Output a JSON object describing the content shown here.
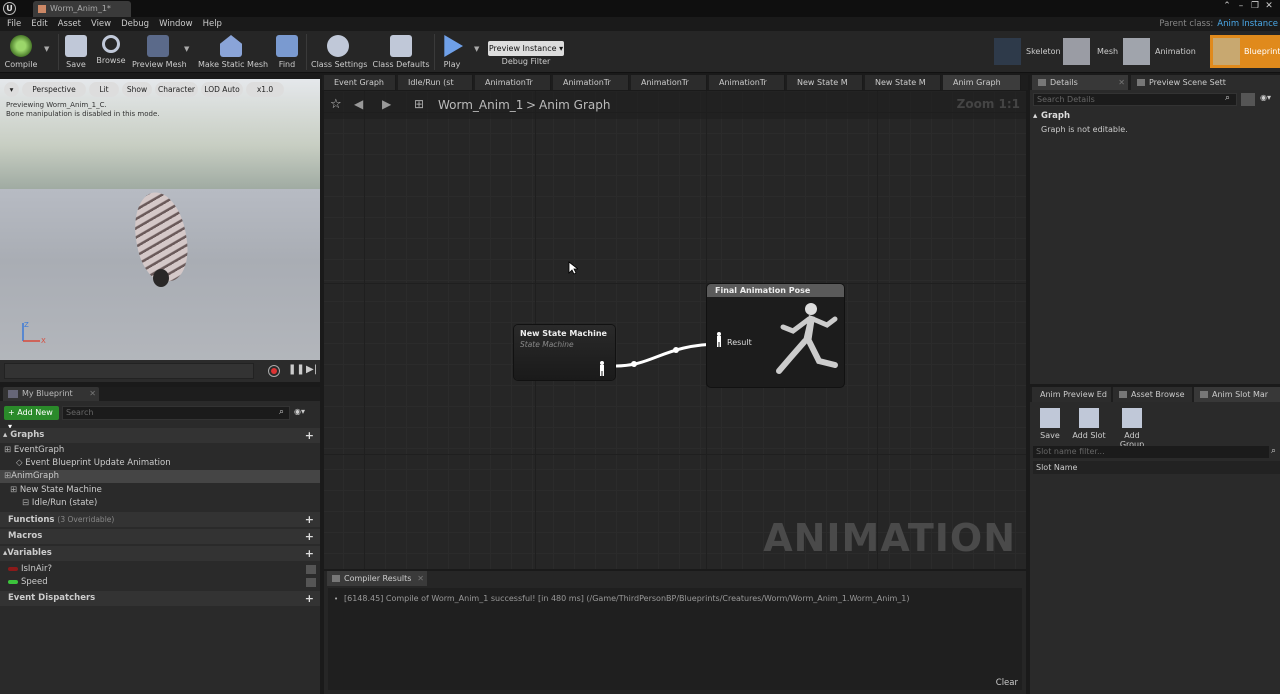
{
  "window": {
    "doc_tab": "Worm_Anim_1*",
    "menu": [
      "File",
      "Edit",
      "Asset",
      "View",
      "Debug",
      "Window",
      "Help"
    ],
    "parent_class_label": "Parent class:",
    "parent_class_value": "Anim Instance"
  },
  "toolbar": {
    "compile": "Compile",
    "save": "Save",
    "browse": "Browse",
    "preview_mesh": "Preview Mesh",
    "make_static_mesh": "Make Static Mesh",
    "find": "Find",
    "class_settings": "Class Settings",
    "class_defaults": "Class Defaults",
    "play": "Play",
    "preview_instance": "Preview Instance",
    "debug_filter": "Debug Filter",
    "modes": [
      "Skeleton",
      "Mesh",
      "Animation",
      "Blueprint"
    ]
  },
  "viewport": {
    "buttons": [
      "Perspective",
      "Lit",
      "Show",
      "Character",
      "LOD Auto",
      "x1.0"
    ],
    "msg1": "Previewing Worm_Anim_1_C.",
    "msg2": "Bone manipulation is disabled in this mode."
  },
  "my_blueprint": {
    "tab": "My Blueprint",
    "add_new": "Add New",
    "search_placeholder": "Search",
    "graphs": "Graphs",
    "event_graph": "EventGraph",
    "event_update": "Event Blueprint Update Animation",
    "anim_graph": "AnimGraph",
    "new_state_machine": "New State Machine",
    "idle_run": "Idle/Run (state)",
    "functions": "Functions",
    "functions_note": "(3 Overridable)",
    "macros": "Macros",
    "variables": "Variables",
    "var1": "IsInAir?",
    "var2": "Speed",
    "event_dispatchers": "Event Dispatchers",
    "colors": {
      "var1": "#8b1a1a",
      "var2": "#3cc43c"
    }
  },
  "doc_tabs": [
    "Event Graph",
    "Idle/Run (st",
    "AnimationTr",
    "AnimationTr",
    "AnimationTr",
    "AnimationTr",
    "New State M",
    "New State M",
    "Anim Graph"
  ],
  "graph": {
    "breadcrumb_root": "Worm_Anim_1",
    "breadcrumb_sep": ">",
    "breadcrumb_current": "Anim Graph",
    "zoom": "Zoom 1:1",
    "watermark": "ANIMATION",
    "sm_title": "New State Machine",
    "sm_subtitle": "State Machine",
    "fp_title": "Final Animation Pose",
    "fp_result": "Result"
  },
  "compiler": {
    "tab": "Compiler Results",
    "message": "[6148.45] Compile of Worm_Anim_1 successful! [in 480 ms] (/Game/ThirdPersonBP/Blueprints/Creatures/Worm/Worm_Anim_1.Worm_Anim_1)",
    "clear": "Clear"
  },
  "details": {
    "tab1": "Details",
    "tab2": "Preview Scene Sett",
    "search_placeholder": "Search Details",
    "section": "Graph",
    "message": "Graph is not editable."
  },
  "slots": {
    "tabs": [
      "Anim Preview Ed",
      "Asset Browse",
      "Anim Slot Mar"
    ],
    "save": "Save",
    "add_slot": "Add Slot",
    "add_group": "Add Group",
    "filter_placeholder": "Slot name filter...",
    "column": "Slot Name"
  }
}
